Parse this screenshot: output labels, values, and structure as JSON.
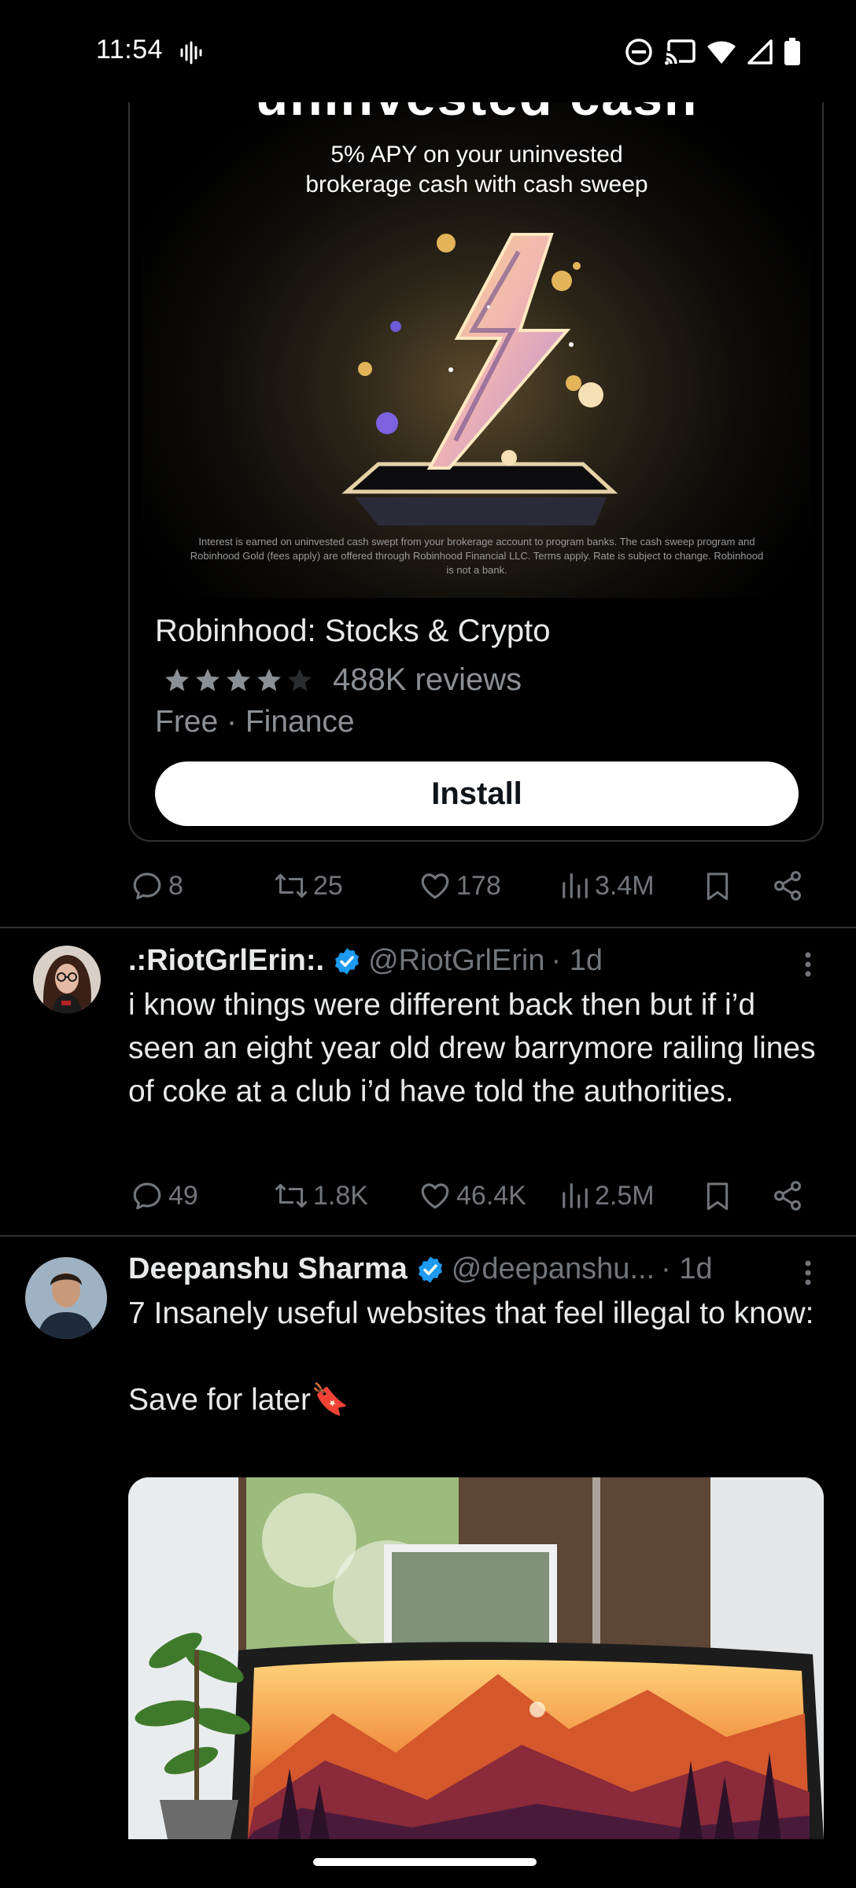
{
  "status_bar": {
    "time": "11:54",
    "icons": [
      "voicemail-icon",
      "dnd-icon",
      "cast-icon",
      "wifi-icon",
      "signal-icon",
      "battery-icon"
    ]
  },
  "promo": {
    "heading_partial": "uninvested cash",
    "subtitle": "5% APY on your uninvested brokerage cash with cash sweep",
    "fine_print": "Interest is earned on uninvested cash swept from your brokerage account to program banks. The cash sweep program and Robinhood Gold (fees apply) are offered through Robinhood Financial LLC. Terms apply. Rate is subject to change. Robinhood is not a bank.",
    "app_name": "Robinhood: Stocks & Crypto",
    "rating": 4,
    "reviews": "488K reviews",
    "meta": "Free · Finance",
    "install_label": "Install",
    "actions": {
      "replies": "8",
      "reposts": "25",
      "likes": "178",
      "views": "3.4M"
    }
  },
  "tweets": [
    {
      "name": ".:RiotGrlErin:.",
      "handle": "@RiotGrlErin",
      "time": "· 1d",
      "text": "i know things were different back then but if i’d seen an eight year old drew barrymore railing lines of coke at a club i’d have told the authorities.",
      "actions": {
        "replies": "49",
        "reposts": "1.8K",
        "likes": "46.4K",
        "views": "2.5M"
      }
    },
    {
      "name": "Deepanshu Sharma",
      "handle": "@deepanshu...",
      "time": "· 1d",
      "text": "7 Insanely useful websites that feel illegal to know:\n\nSave for later🔖"
    }
  ],
  "colors": {
    "background": "#000000",
    "muted": "#71767b",
    "verified": "#1d9bf0",
    "divider": "#2f3336"
  }
}
